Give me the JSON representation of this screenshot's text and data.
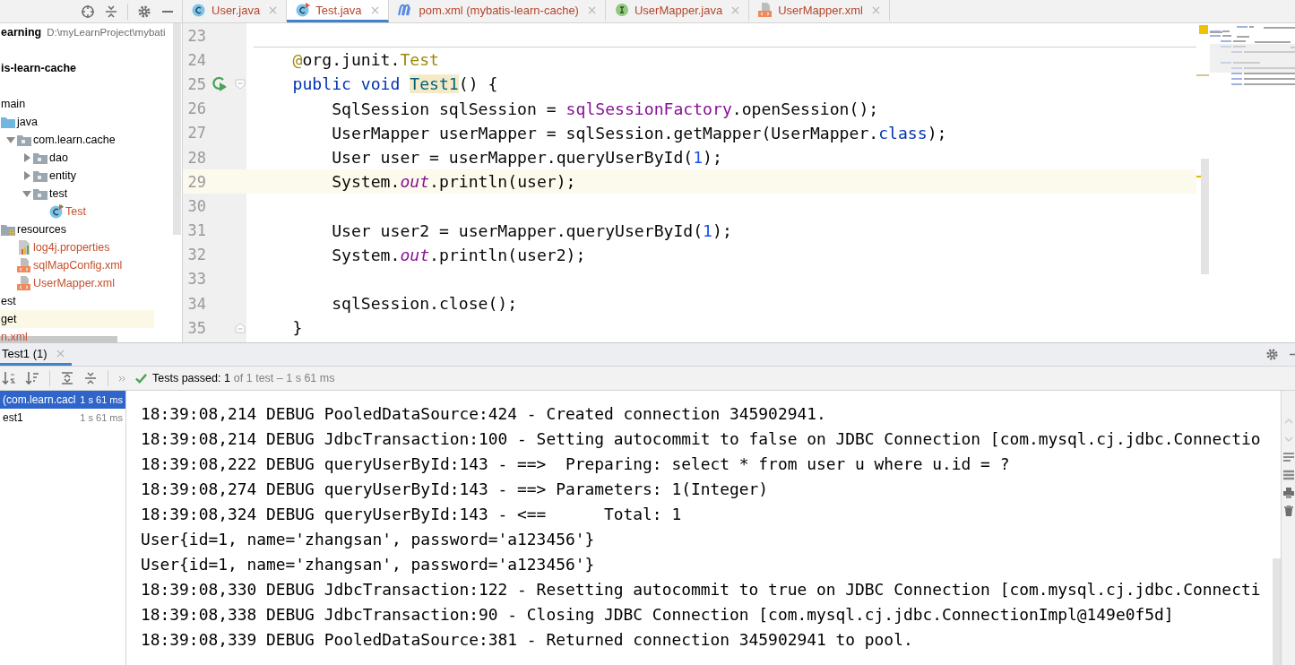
{
  "project_panel": {
    "tree": [
      {
        "label": "earning",
        "kind": "module",
        "path": "D:\\myLearnProject\\mybati",
        "unversioned": false
      },
      {
        "label": "is-learn-cache",
        "kind": "module",
        "unversioned": false
      },
      {
        "label": "main",
        "unversioned": false,
        "children": [
          {
            "label": "java",
            "kind": "source-folder",
            "unversioned": false,
            "children": [
              {
                "label": "com.learn.cache",
                "kind": "package",
                "expanded": true,
                "unversioned": false,
                "children": [
                  {
                    "label": "dao",
                    "kind": "package",
                    "expanded": false,
                    "unversioned": false
                  },
                  {
                    "label": "entity",
                    "kind": "package",
                    "expanded": false,
                    "unversioned": false
                  },
                  {
                    "label": "test",
                    "kind": "package",
                    "expanded": true,
                    "unversioned": false,
                    "children": [
                      {
                        "label": "Test",
                        "kind": "test-class",
                        "unversioned": true
                      }
                    ]
                  }
                ]
              }
            ]
          },
          {
            "label": "resources",
            "kind": "resource-folder",
            "unversioned": false,
            "children": [
              {
                "label": "log4j.properties",
                "kind": "properties",
                "unversioned": true
              },
              {
                "label": "sqlMapConfig.xml",
                "kind": "xml",
                "unversioned": true
              },
              {
                "label": "UserMapper.xml",
                "kind": "xml",
                "unversioned": true
              }
            ]
          }
        ]
      },
      {
        "label": "est",
        "unversioned": false
      },
      {
        "label": "get",
        "kind": "excluded-folder",
        "unversioned": false
      },
      {
        "label": "n.xml",
        "unversioned": true
      }
    ]
  },
  "editor_tabs": [
    {
      "label": "User.java",
      "kind": "class",
      "selected": false
    },
    {
      "label": "Test.java",
      "kind": "test-class",
      "selected": true
    },
    {
      "label": "pom.xml (mybatis-learn-cache)",
      "kind": "maven",
      "selected": false
    },
    {
      "label": "UserMapper.java",
      "kind": "interface",
      "selected": false
    },
    {
      "label": "UserMapper.xml",
      "kind": "xml",
      "selected": false
    }
  ],
  "editor": {
    "lines": [
      {
        "number": "23",
        "current": false
      },
      {
        "number": "24",
        "current": false,
        "tokens": [
          {
            "text": "    @",
            "kind": "annotation"
          },
          {
            "text": "org.junit.",
            "kind": "plain"
          },
          {
            "text": "Test",
            "kind": "annotation"
          }
        ]
      },
      {
        "number": "25",
        "current": false,
        "gutter": [
          {
            "kind": "run"
          },
          {
            "kind": "fold-start"
          }
        ],
        "tokens": [
          {
            "text": "    public void ",
            "kind": "keyword"
          },
          {
            "text": "Test1",
            "kind": "declaration"
          },
          {
            "text": "() {",
            "kind": "plain"
          }
        ]
      },
      {
        "number": "26",
        "current": false,
        "tokens": [
          {
            "text": "        SqlSession sqlSession = ",
            "kind": "plain"
          },
          {
            "text": "sqlSessionFactory",
            "kind": "field"
          },
          {
            "text": ".openSession();",
            "kind": "plain"
          }
        ]
      },
      {
        "number": "27",
        "current": false,
        "tokens": [
          {
            "text": "        UserMapper userMapper = sqlSession.getMapper(UserMapper.",
            "kind": "plain"
          },
          {
            "text": "class",
            "kind": "keyword"
          },
          {
            "text": ");",
            "kind": "plain"
          }
        ]
      },
      {
        "number": "28",
        "current": false,
        "tokens": [
          {
            "text": "        User user = userMapper.queryUserById(",
            "kind": "plain"
          },
          {
            "text": "1",
            "kind": "number"
          },
          {
            "text": ");",
            "kind": "plain"
          }
        ]
      },
      {
        "number": "29",
        "current": true,
        "tokens": [
          {
            "text": "        System.",
            "kind": "plain"
          },
          {
            "text": "out",
            "kind": "static"
          },
          {
            "text": ".println(user);",
            "kind": "plain"
          }
        ]
      },
      {
        "number": "30",
        "current": false
      },
      {
        "number": "31",
        "current": false,
        "tokens": [
          {
            "text": "        User user2 = userMapper.queryUserById(",
            "kind": "plain"
          },
          {
            "text": "1",
            "kind": "number"
          },
          {
            "text": ");",
            "kind": "plain"
          }
        ]
      },
      {
        "number": "32",
        "current": false,
        "tokens": [
          {
            "text": "        System.",
            "kind": "plain"
          },
          {
            "text": "out",
            "kind": "static"
          },
          {
            "text": ".println(user2);",
            "kind": "plain"
          }
        ]
      },
      {
        "number": "33",
        "current": false
      },
      {
        "number": "34",
        "current": false,
        "tokens": [
          {
            "text": "        sqlSession.close();",
            "kind": "plain"
          }
        ]
      },
      {
        "number": "35",
        "current": false,
        "gutter": [
          {
            "kind": "fold-end"
          }
        ],
        "tokens": [
          {
            "text": "    }",
            "kind": "plain"
          }
        ]
      }
    ]
  },
  "run_panel": {
    "tab": {
      "label": "Test1 (1)",
      "selected": true
    },
    "status": {
      "summary": "Tests passed: 1",
      "detail": "of 1 test – 1 s 61 ms"
    },
    "tests": [
      {
        "name": "(com.learn.cacl",
        "time": "1 s 61 ms",
        "selected": true
      },
      {
        "name": "est1",
        "time": "1 s 61 ms",
        "selected": false
      }
    ],
    "console": [
      "18:39:08,214 DEBUG PooledDataSource:424 - Created connection 345902941.",
      "18:39:08,214 DEBUG JdbcTransaction:100 - Setting autocommit to false on JDBC Connection [com.mysql.cj.jdbc.Connectio",
      "18:39:08,222 DEBUG queryUserById:143 - ==>  Preparing: select * from user u where u.id = ?",
      "18:39:08,274 DEBUG queryUserById:143 - ==> Parameters: 1(Integer)",
      "18:39:08,324 DEBUG queryUserById:143 - <==      Total: 1",
      "User{id=1, name='zhangsan', password='a123456'}",
      "User{id=1, name='zhangsan', password='a123456'}",
      "18:39:08,330 DEBUG JdbcTransaction:122 - Resetting autocommit to true on JDBC Connection [com.mysql.cj.jdbc.Connecti",
      "18:39:08,338 DEBUG JdbcTransaction:90 - Closing JDBC Connection [com.mysql.cj.jdbc.ConnectionImpl@149e0f5d]",
      "18:39:08,339 DEBUG PooledDataSource:381 - Returned connection 345902941 to pool."
    ]
  }
}
